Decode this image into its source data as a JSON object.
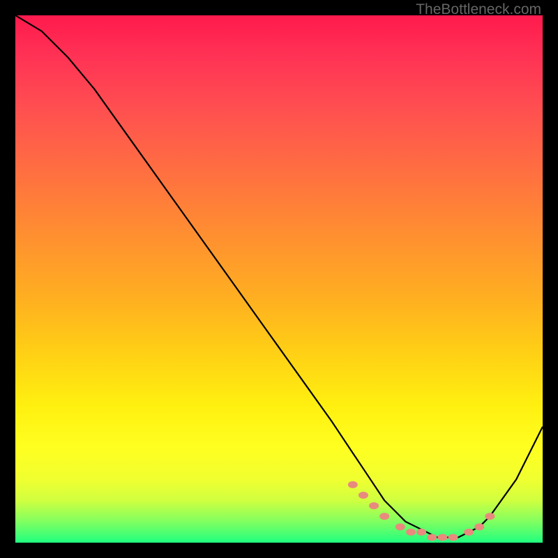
{
  "watermark": "TheBottleneck.com",
  "chart_data": {
    "type": "line",
    "title": "",
    "xlabel": "",
    "ylabel": "",
    "xlim": [
      0,
      100
    ],
    "ylim": [
      0,
      100
    ],
    "series": [
      {
        "name": "curve",
        "x": [
          0,
          5,
          10,
          15,
          20,
          25,
          30,
          35,
          40,
          45,
          50,
          55,
          60,
          62,
          64,
          66,
          68,
          70,
          72,
          74,
          76,
          78,
          80,
          82,
          84,
          86,
          88,
          90,
          95,
          100
        ],
        "y": [
          100,
          97,
          92,
          86,
          79,
          72,
          65,
          58,
          51,
          44,
          37,
          30,
          23,
          20,
          17,
          14,
          11,
          8,
          6,
          4,
          3,
          2,
          1,
          1,
          1,
          2,
          3,
          5,
          12,
          22
        ]
      }
    ],
    "markers": {
      "name": "dots",
      "color": "#e88a7d",
      "x": [
        64,
        66,
        68,
        70,
        73,
        75,
        77,
        79,
        81,
        83,
        86,
        88,
        90
      ],
      "y": [
        11,
        9,
        7,
        5,
        3,
        2,
        2,
        1,
        1,
        1,
        2,
        3,
        5
      ]
    }
  }
}
